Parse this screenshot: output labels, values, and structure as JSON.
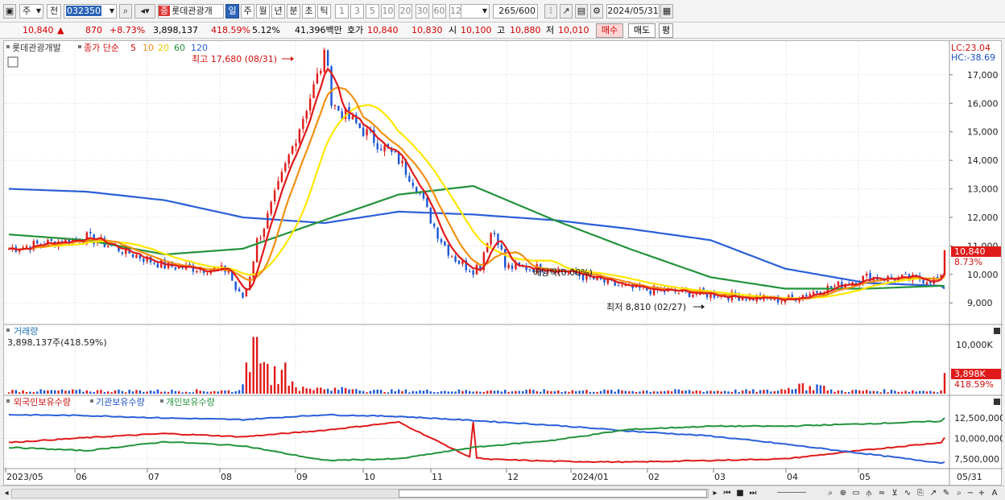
{
  "toolbar": {
    "market": "주",
    "scope": "전",
    "code": "032350",
    "name": "롯데관광개",
    "period_tabs": [
      "일",
      "주",
      "월",
      "년",
      "분",
      "초",
      "틱"
    ],
    "period_selected": "일",
    "minute_options": [
      "1",
      "3",
      "5",
      "10",
      "20",
      "30",
      "60",
      "120"
    ],
    "count": "265",
    "total": "/600",
    "date": "2024/05/31"
  },
  "info": {
    "price": "10,840",
    "arrow": "▲",
    "change": "870",
    "change_pct": "+8.73%",
    "volume": "3,898,137",
    "volume_pct": "418.59%",
    "turnover_pct": "5.12%",
    "trade_value": "41,396백만",
    "quote_label": "호가",
    "ask": "10,840",
    "bid": "10,830",
    "open_label": "시",
    "open": "10,100",
    "high_label": "고",
    "high": "10,880",
    "low_label": "저",
    "low": "10,010",
    "buy": "매수",
    "sell": "매도",
    "eval": "평"
  },
  "chart": {
    "legend_name": "롯데관광개발",
    "legend_ma": "종가 단순",
    "ma_periods": [
      "5",
      "10",
      "20",
      "60",
      "120"
    ],
    "lc": "LC:23.04",
    "hc": "HC:-38.69",
    "max_note": "최고 17,680 (08/31)",
    "min_note": "최저 8,810 (02/27)",
    "div_note": "배당락(0.00%)",
    "price_ticks": [
      "17,000",
      "16,000",
      "15,000",
      "14,000",
      "13,000",
      "12,000",
      "11,000",
      "10,000",
      "9,000"
    ],
    "current_price": "10,840",
    "current_pct": "8.73%",
    "volume_title": "거래량",
    "volume_value": "3,898,137주(418.59%)",
    "volume_tick": "10,000K",
    "volume_current": "3,898K",
    "volume_pct": "418.59%",
    "holder_titles": [
      "외국인보유수량",
      "기관보유수량",
      "개인보유수량"
    ],
    "holder_ticks": [
      "12,500,000",
      "10,000,000",
      "7,500,000"
    ],
    "x_labels": [
      "2023/05",
      "06",
      "07",
      "08",
      "09",
      "10",
      "11",
      "12",
      "2024/01",
      "02",
      "03",
      "04",
      "05",
      "05/31"
    ],
    "colors": {
      "up": "#e01a1a",
      "down": "#1c55d6",
      "ma5": "#e01a1a",
      "ma10": "#f39012",
      "ma20": "#ffe600",
      "ma60": "#22933c",
      "ma120": "#2a5fd8"
    }
  },
  "chart_data": {
    "type": "line",
    "x": [
      "2023/05",
      "2023/06",
      "2023/07",
      "2023/08",
      "2023/09",
      "2023/10",
      "2023/11",
      "2023/12",
      "2024/01",
      "2024/02",
      "2024/03",
      "2024/04",
      "2024/05",
      "2024/05/31"
    ],
    "series": [
      {
        "name": "종가",
        "values": [
          10900,
          11300,
          10300,
          10100,
          16200,
          14000,
          10300,
          10200,
          9500,
          9300,
          9100,
          9900,
          9800,
          10840
        ]
      },
      {
        "name": "60",
        "values": [
          11400,
          11200,
          10700,
          10900,
          11900,
          12800,
          13100,
          11900,
          10900,
          9900,
          9500,
          9500,
          9600,
          9600
        ]
      },
      {
        "name": "120",
        "values": [
          13000,
          12900,
          12600,
          12000,
          11800,
          12200,
          12100,
          11900,
          11600,
          11200,
          10200,
          9700,
          9600,
          9500
        ]
      }
    ],
    "ylim": [
      8300,
      17900
    ],
    "max": {
      "date": "08/31",
      "value": 17680
    },
    "min": {
      "date": "02/27",
      "value": 8810
    },
    "volume": {
      "last": 3898137,
      "last_pct": 418.59
    },
    "holders": {
      "series": [
        {
          "name": "외국인보유수량",
          "values": [
            9500000,
            10100000,
            10600000,
            10200000,
            11000000,
            12000000,
            7500000,
            7200000,
            7100000,
            7300000,
            7500000,
            8600000,
            9500000,
            10100000
          ]
        },
        {
          "name": "기관보유수량",
          "values": [
            12900000,
            12800000,
            12500000,
            12300000,
            12900000,
            12700000,
            12200000,
            11600000,
            10900000,
            10300000,
            9300000,
            8100000,
            7000000,
            7100000
          ]
        },
        {
          "name": "개인보유수량",
          "values": [
            8900000,
            8500000,
            9600000,
            9100000,
            7300000,
            7500000,
            8900000,
            9800000,
            11100000,
            11500000,
            11500000,
            11800000,
            12100000,
            12500000
          ]
        }
      ]
    }
  }
}
